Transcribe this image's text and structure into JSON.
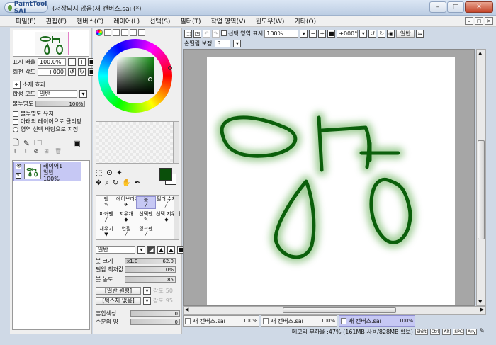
{
  "window": {
    "app_logo": "PaintTool SAI",
    "title": "(저장되지 않음)새 캔버스.sai (*)"
  },
  "menu": [
    "파일(F)",
    "편집(E)",
    "캔버스(C)",
    "레이어(L)",
    "선택(S)",
    "필터(T)",
    "작업 영역(V)",
    "윈도우(W)",
    "기타(O)"
  ],
  "navigator": {
    "zoom_label": "표시 배율",
    "zoom_value": "100.0%",
    "angle_label": "회전 각도",
    "angle_value": "+000"
  },
  "layer_panel": {
    "effect_label": "소재 효과",
    "blend_label": "합성 모드",
    "blend_value": "일반",
    "opacity_label": "불투명도",
    "opacity_value": "100%",
    "opt1": "불투명도 유지",
    "opt2": "아래의 레이어으로 클리핑",
    "opt3": "영역 선택 바탕으로 지정",
    "layer": {
      "name": "레이어1",
      "mode": "일반",
      "opacity": "100%"
    }
  },
  "tools": {
    "items": [
      {
        "label": "펜"
      },
      {
        "label": "에어브러쉬"
      },
      {
        "label": "붓"
      },
      {
        "label": "필러 수채"
      },
      {
        "label": "마커펜"
      },
      {
        "label": "지우개"
      },
      {
        "label": "선택펜"
      },
      {
        "label": "선택 지우개"
      },
      {
        "label": "채우기"
      },
      {
        "label": "연필"
      },
      {
        "label": "잉크펜"
      }
    ],
    "selected": "붓"
  },
  "brush": {
    "mode": "일반",
    "size_label": "붓 크기",
    "size_mult": "x1.0",
    "size_value": "62.0",
    "minsize_label": "필압 최저값",
    "minsize_value": "0%",
    "density_label": "붓 농도",
    "density_value": "85",
    "shape_label": "[일반 원형]",
    "shape_strength": "강도",
    "shape_value": "50",
    "texture_label": "[텍스처 없음]",
    "texture_strength": "강도",
    "texture_value": "95",
    "mix_label": "혼합색상",
    "mix_value": "0",
    "water_label": "수분의 양",
    "water_value": "0"
  },
  "toolbar": {
    "selection_label": "선택 영역 표시",
    "zoom": "100%",
    "rotation": "+000°",
    "mode": "일반",
    "stabilizer_label": "손떨림 보정",
    "stabilizer_value": "3"
  },
  "documents": [
    {
      "name": "새 캔버스.sai",
      "zoom": "100%"
    },
    {
      "name": "새 캔버스.sai",
      "zoom": "100%"
    },
    {
      "name": "새 캔버스.sai",
      "zoom": "100%",
      "active": true
    }
  ],
  "status": {
    "memory": "메모리 부하율 :47% (161MB 사용/828MB 확보)",
    "keys": [
      "Shift",
      "Ctrl",
      "Alt",
      "SPC",
      "Any"
    ]
  },
  "colors": {
    "brush": "#0a5a0a",
    "accent": "#c6c8f4"
  }
}
